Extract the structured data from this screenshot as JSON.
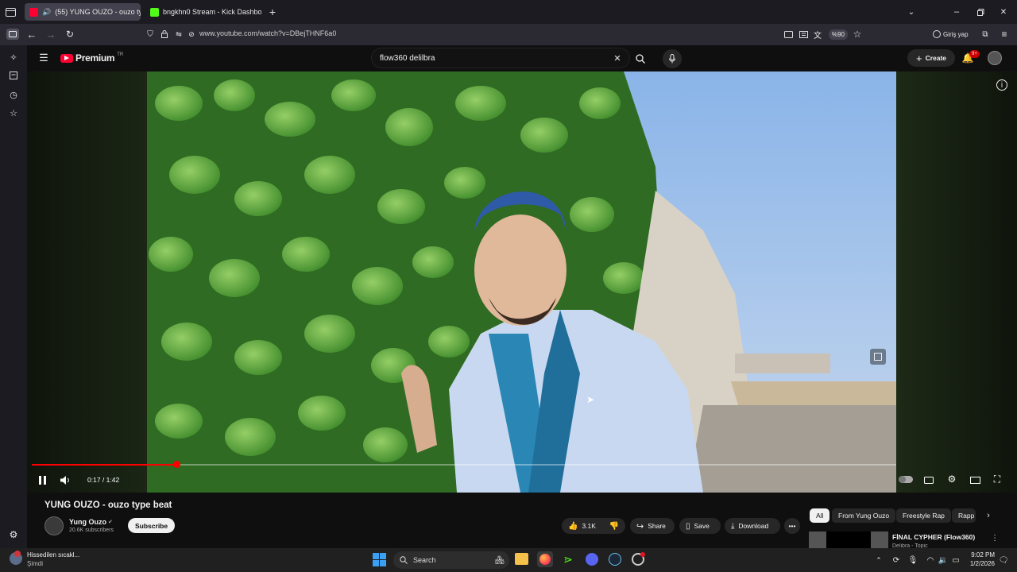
{
  "browser": {
    "tabs": [
      {
        "title": "(55) YUNG OUZO - ouzo ty",
        "active": true,
        "fav_color": "#ff0033"
      },
      {
        "title": "bngkhn0 Stream - Kick Dashbo",
        "active": false,
        "fav_color": "#53fc18"
      }
    ],
    "url": "www.youtube.com/watch?v=DBejTHNF6a0",
    "zoom": "%90",
    "signin_label": "Giriş yap"
  },
  "yt": {
    "logo_text": "Premium",
    "logo_region": "TR",
    "search_value": "flow360 delilbra",
    "create_label": "Create",
    "notif_count": "9+",
    "player": {
      "time": "0:17 / 1:42",
      "progress": 0.167
    },
    "video": {
      "title": "YUNG OUZO - ouzo type beat",
      "channel": "Yung Ouzo",
      "subscribers": "20.6K subscribers",
      "subscribe_label": "Subscribe",
      "likes": "3.1K",
      "share_label": "Share",
      "save_label": "Save",
      "download_label": "Download"
    },
    "chips": [
      "All",
      "From Yung Ouzo",
      "Freestyle Rap",
      "Rapp"
    ],
    "related_title": "FİNAL CYPHER (Flow360)",
    "related_sub": "Delibra - Topic"
  },
  "taskbar": {
    "weather_title": "Hissedilen sıcakl...",
    "weather_sub": "Şimdi",
    "search_label": "Search",
    "time": "9:02 PM",
    "date": "1/2/2026"
  },
  "colors": {
    "yt_red": "#ff0033",
    "progress_red": "#f00",
    "bg": "#0f0f0f"
  }
}
